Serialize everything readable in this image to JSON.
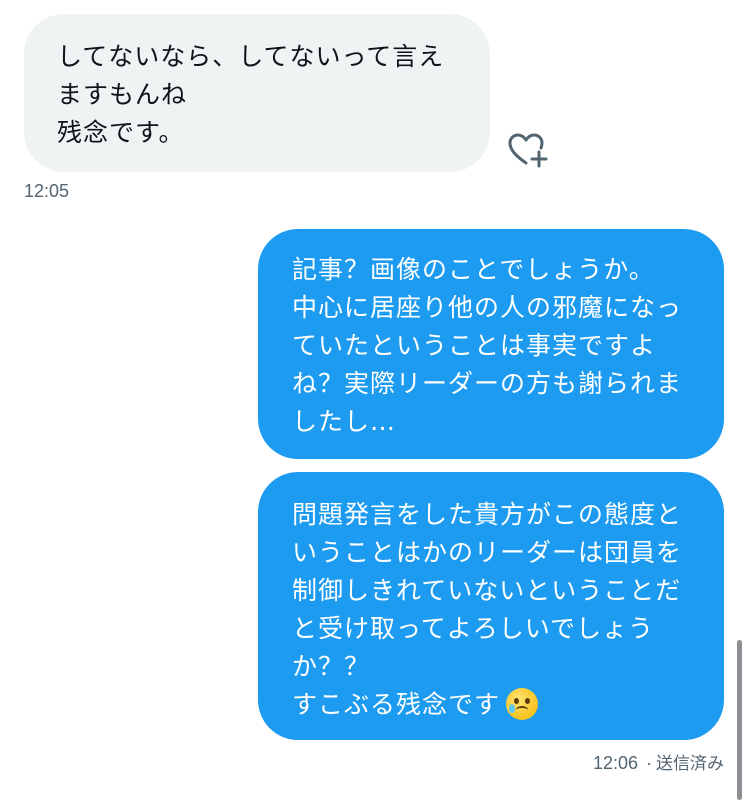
{
  "messages": [
    {
      "direction": "in",
      "text": "してないなら、してないって言え\nますもんね\n残念です。",
      "time": "12:05"
    },
    {
      "direction": "out",
      "text": "記事？画像のことでしょうか。\n中心に居座り他の人の邪魔になっ\nていたということは事実ですよ\nね？実際リーダーの方も謝られま\nしたし…"
    },
    {
      "direction": "out",
      "text": "問題発言をした貴方がこの態度と\nいうことはかのリーダーは団員を\n制御しきれていないということだ\nと受け取ってよろしいでしょう\nか？？\nすこぶる残念です",
      "emoji": "crying-face",
      "time": "12:06",
      "status": "送信済み",
      "separator": "·"
    }
  ],
  "colors": {
    "incoming_bg": "#eff3f4",
    "outgoing_bg": "#1d9bf0",
    "meta_text": "#536471"
  },
  "icons": {
    "reaction": "heart-plus-icon"
  }
}
